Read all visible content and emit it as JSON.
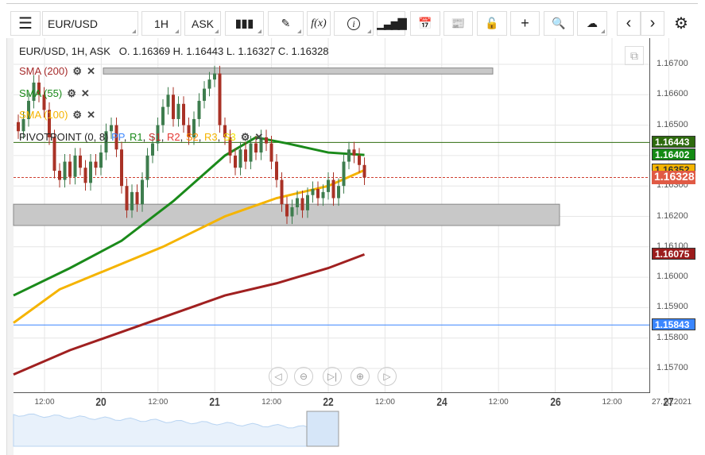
{
  "toolbar": {
    "symbol": "EUR/USD",
    "timeframe": "1H",
    "price_type": "ASK",
    "icons": [
      "menu-icon",
      "chart-type-icon",
      "draw-icon",
      "function-icon",
      "info-icon",
      "volume-icon",
      "calendar-icon",
      "news-icon",
      "lock-icon",
      "crosshair-icon",
      "zoom-search-icon",
      "cloud-upload-icon",
      "prev-icon",
      "next-icon",
      "settings-icon"
    ],
    "fx_label": "f(x)"
  },
  "chart": {
    "header": "EUR/USD, 1H, ASK",
    "ohlc": "O. 1.16369 H. 1.16443 L. 1.16327 C. 1.16328",
    "indicators": [
      {
        "label": "SMA (200)",
        "color": "#a52a2a"
      },
      {
        "label": "SMA (55)",
        "color": "#1a8a1a"
      },
      {
        "label": "SMA (100)",
        "color": "#f5b400"
      }
    ],
    "pivot": {
      "label": "PIVOTPOINT (0, 8)",
      "parts": [
        {
          "t": "PP",
          "c": "#3a86ff"
        },
        {
          "t": "R1",
          "c": "#1a8a1a"
        },
        {
          "t": "S1",
          "c": "#c62828"
        },
        {
          "t": "R2",
          "c": "#e53935"
        },
        {
          "t": "S2",
          "c": "#ff8c00"
        },
        {
          "t": "R3",
          "c": "#f5b400"
        },
        {
          "t": "S3",
          "c": "#f0e000"
        }
      ]
    },
    "price_labels": [
      {
        "v": "1.16443",
        "bg": "#2e6b0e",
        "p": 1.16443
      },
      {
        "v": "1.16402",
        "bg": "#138a13",
        "p": 1.16402
      },
      {
        "v": "1.16352",
        "bg": "#f5b400",
        "p": 1.16352
      },
      {
        "v": "1.16328",
        "bg": "#e05a45",
        "p": 1.16328
      },
      {
        "v": "1.16075",
        "bg": "#9b1c1c",
        "p": 1.16075
      },
      {
        "v": "1.15843",
        "bg": "#3a86ff",
        "p": 1.15843
      }
    ],
    "y_ticks": [
      "1.16700",
      "1.16600",
      "1.16500",
      "1.16400",
      "1.16300",
      "1.16200",
      "1.16100",
      "1.16000",
      "1.15900",
      "1.15800",
      "1.15700"
    ],
    "x_ticks": [
      {
        "t": "12:00",
        "d": false,
        "h": 0
      },
      {
        "t": "20",
        "d": true,
        "h": 12
      },
      {
        "t": "12:00",
        "d": false,
        "h": 24
      },
      {
        "t": "21",
        "d": true,
        "h": 36
      },
      {
        "t": "12:00",
        "d": false,
        "h": 48
      },
      {
        "t": "22",
        "d": true,
        "h": 60
      },
      {
        "t": "12:00",
        "d": false,
        "h": 72
      },
      {
        "t": "24",
        "d": true,
        "h": 84
      },
      {
        "t": "12:00",
        "d": false,
        "h": 96
      },
      {
        "t": "26",
        "d": true,
        "h": 108
      },
      {
        "t": "12:00",
        "d": false,
        "h": 120
      },
      {
        "t": "27",
        "d": true,
        "h": 132
      }
    ],
    "date_label": "27.10.2021"
  },
  "chart_data": {
    "type": "candlestick",
    "symbol": "EUR/USD",
    "interval": "1H",
    "ylim": [
      1.1565,
      1.1678
    ],
    "closes": [
      1.1648,
      1.1652,
      1.1658,
      1.1664,
      1.166,
      1.1655,
      1.1646,
      1.1635,
      1.1632,
      1.1638,
      1.1633,
      1.164,
      1.1636,
      1.1631,
      1.1638,
      1.1636,
      1.1641,
      1.1648,
      1.165,
      1.1642,
      1.163,
      1.1622,
      1.1628,
      1.1624,
      1.1632,
      1.164,
      1.1644,
      1.165,
      1.1656,
      1.166,
      1.1652,
      1.1657,
      1.165,
      1.1646,
      1.1652,
      1.1658,
      1.1662,
      1.1665,
      1.1667,
      1.165,
      1.1646,
      1.164,
      1.1636,
      1.1642,
      1.1638,
      1.1644,
      1.1641,
      1.1646,
      1.1644,
      1.1638,
      1.1632,
      1.1624,
      1.162,
      1.1623,
      1.1626,
      1.1622,
      1.1627,
      1.1629,
      1.1626,
      1.1628,
      1.1632,
      1.1626,
      1.163,
      1.1638,
      1.1642,
      1.164,
      1.16369,
      1.16328
    ],
    "sma55": [
      [
        0,
        1.1594
      ],
      [
        10,
        1.1603
      ],
      [
        20,
        1.1612
      ],
      [
        30,
        1.1625
      ],
      [
        40,
        1.164
      ],
      [
        46,
        1.1646
      ],
      [
        52,
        1.1644
      ],
      [
        60,
        1.1641
      ],
      [
        67,
        1.16402
      ]
    ],
    "sma100": [
      [
        0,
        1.1585
      ],
      [
        8,
        1.1596
      ],
      [
        18,
        1.1603
      ],
      [
        28,
        1.161
      ],
      [
        40,
        1.162
      ],
      [
        50,
        1.1626
      ],
      [
        60,
        1.163
      ],
      [
        67,
        1.16352
      ]
    ],
    "sma200": [
      [
        0,
        1.1568
      ],
      [
        10,
        1.1576
      ],
      [
        20,
        1.1582
      ],
      [
        30,
        1.1588
      ],
      [
        40,
        1.1594
      ],
      [
        50,
        1.1598
      ],
      [
        60,
        1.1603
      ],
      [
        67,
        1.16075
      ]
    ],
    "hlines": [
      {
        "p": 1.16443,
        "color": "#2e6b0e"
      },
      {
        "p": 1.15843,
        "color": "#3a86ff"
      }
    ],
    "zones": [
      [
        1.1624,
        1.1617
      ],
      [
        1.16688,
        1.16668
      ]
    ]
  }
}
